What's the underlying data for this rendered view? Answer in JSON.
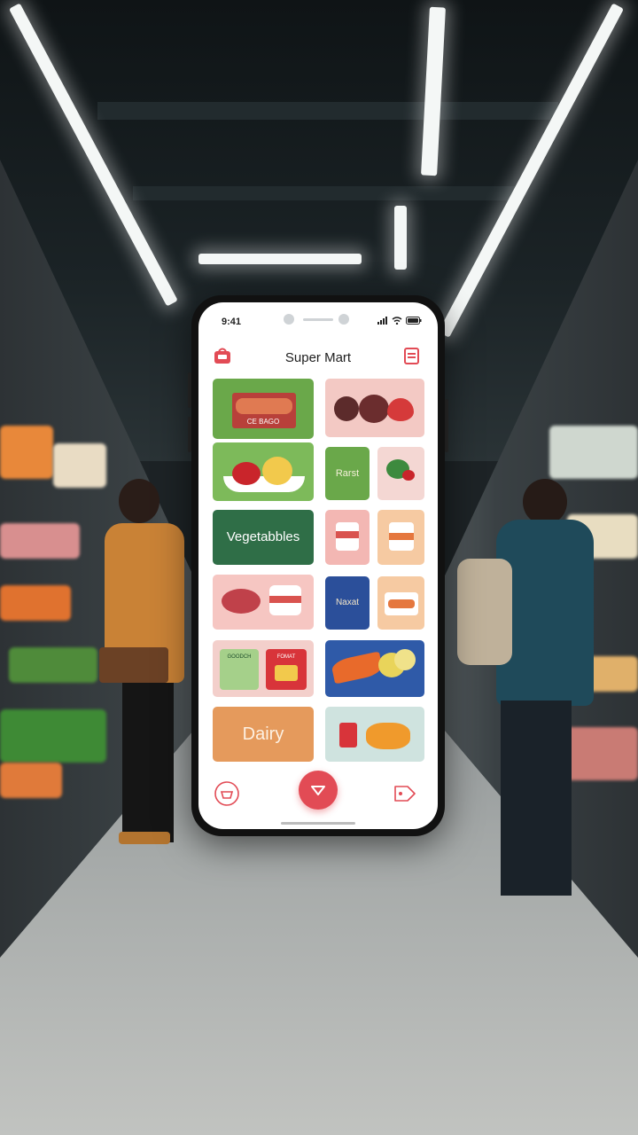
{
  "status_bar": {
    "time": "9:41"
  },
  "app": {
    "title": "Super Mart"
  },
  "categories": {
    "meat_tile_text": "CE BAGO",
    "fruit_tile_label": "Rarst",
    "vegetables_label": "Vegetabbles",
    "nuts_tile_label": "Naxat",
    "dairy_label": "Dairy",
    "drinks_pack_1": "GOODCH",
    "drinks_pack_2": "FOMAT"
  },
  "icons": {
    "header_left": "store-bag-icon",
    "header_right": "cart-icon",
    "nav_left": "basket-icon",
    "nav_center": "heart-icon",
    "nav_right": "tag-icon"
  },
  "colors": {
    "accent": "#e24b55",
    "vegetables_green": "#2f6e47",
    "dairy_orange": "#e59a5c",
    "nuts_blue": "#2b4f9a"
  }
}
